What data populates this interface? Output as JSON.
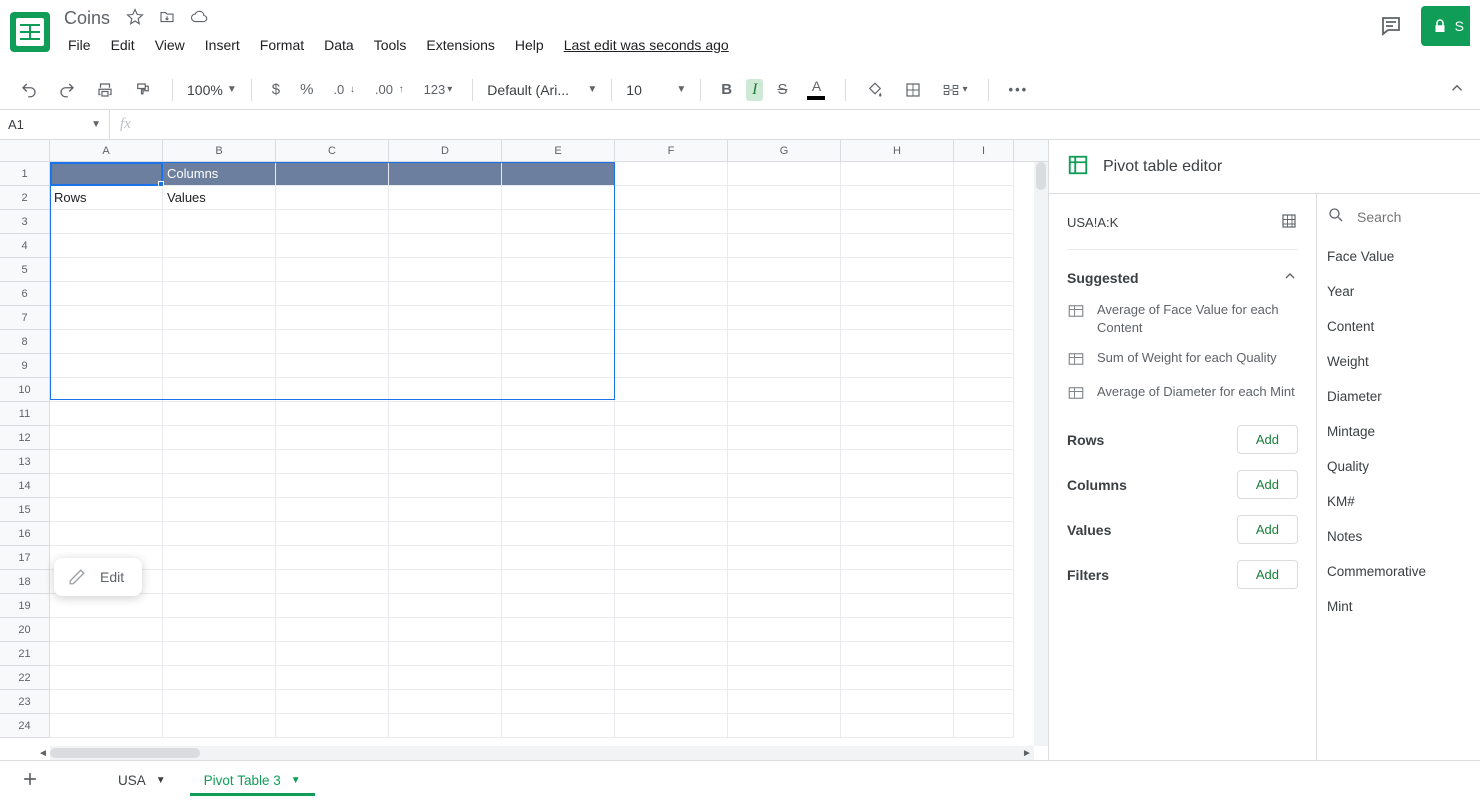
{
  "doc": {
    "title": "Coins",
    "last_edit": "Last edit was seconds ago"
  },
  "menu": {
    "file": "File",
    "edit": "Edit",
    "view": "View",
    "insert": "Insert",
    "format": "Format",
    "data": "Data",
    "tools": "Tools",
    "extensions": "Extensions",
    "help": "Help"
  },
  "share": {
    "label": "S"
  },
  "toolbar": {
    "zoom": "100%",
    "font": "Default (Ari...",
    "font_size": "10",
    "number_format": "123"
  },
  "namebox": "A1",
  "columns": [
    "A",
    "B",
    "C",
    "D",
    "E",
    "F",
    "G",
    "H",
    "I"
  ],
  "pivot_area": {
    "a1": "",
    "b1": "Columns",
    "a2": "Rows",
    "b2": "Values"
  },
  "edit_popover": "Edit",
  "pivot_editor": {
    "title": "Pivot table editor",
    "range": "USA!A:K",
    "search_placeholder": "Search",
    "suggested_label": "Suggested",
    "suggestions": [
      "Average of Face Value for each Content",
      "Sum of Weight for each Quality",
      "Average of Diameter for each Mint"
    ],
    "sections": {
      "rows": "Rows",
      "columns": "Columns",
      "values": "Values",
      "filters": "Filters"
    },
    "add": "Add",
    "fields": [
      "Face Value",
      "Year",
      "Content",
      "Weight",
      "Diameter",
      "Mintage",
      "Quality",
      "KM#",
      "Notes",
      "Commemorative",
      "Mint"
    ]
  },
  "tabs": {
    "sheet1": "USA",
    "sheet2": "Pivot Table 3"
  }
}
